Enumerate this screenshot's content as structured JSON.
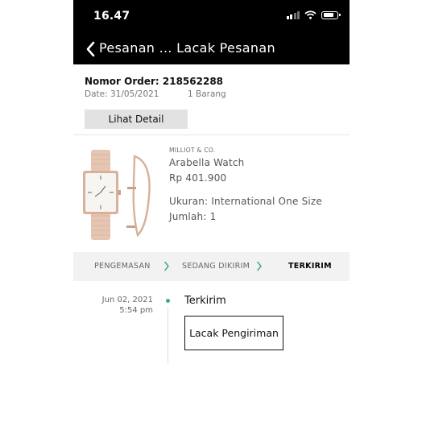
{
  "status_bar": {
    "time": "16.47",
    "icons": [
      "signal-icon",
      "wifi-icon",
      "battery-icon"
    ]
  },
  "nav": {
    "title": "Pesanan ... Lacak Pesanan",
    "back_icon": "chevron-left-icon"
  },
  "order": {
    "number_label": "Nomor Order: 218562288",
    "date": "Date: 31/05/2021",
    "item_count": "1 Barang",
    "detail_button": "Lihat Detail"
  },
  "product": {
    "image": "watch-and-bangle-image",
    "brand": "MILLIOT & CO.",
    "name": "Arabella Watch",
    "price": "Rp 401.900",
    "size": "Ukuran: International One Size",
    "quantity": "Jumlah: 1"
  },
  "steps": {
    "items": [
      {
        "label": "PENGEMASAN",
        "active": false
      },
      {
        "label": "SEDANG DIKIRIM",
        "active": false
      },
      {
        "label": "TERKIRIM",
        "active": true
      }
    ],
    "separator_icon": "chevron-right-icon",
    "separator_color": "#3fa98f"
  },
  "timeline": {
    "date": "Jun 02, 2021",
    "time": "5:54 pm",
    "status": "Terkirim",
    "track_button": "Lacak Pengiriman",
    "dot_color": "#3fa98f"
  }
}
